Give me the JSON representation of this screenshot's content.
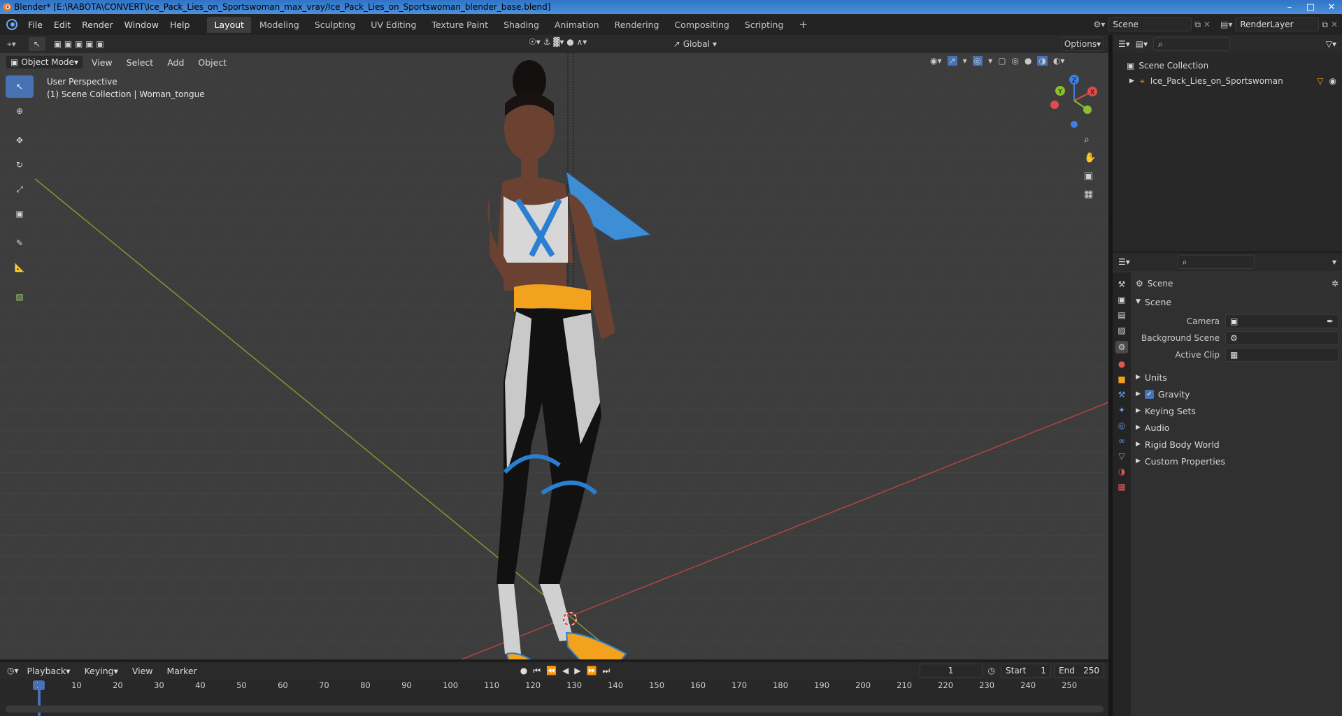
{
  "window": {
    "title": "Blender* [E:\\RABOTA\\CONVERT\\Ice_Pack_Lies_on_Sportswoman_max_vray/Ice_Pack_Lies_on_Sportswoman_blender_base.blend]"
  },
  "menu": [
    "File",
    "Edit",
    "Render",
    "Window",
    "Help"
  ],
  "workspaces": [
    "Layout",
    "Modeling",
    "Sculpting",
    "UV Editing",
    "Texture Paint",
    "Shading",
    "Animation",
    "Rendering",
    "Compositing",
    "Scripting"
  ],
  "scene_field": "Scene",
  "renderlayer_field": "RenderLayer",
  "viewport_header": {
    "orientation": "Global",
    "options": "Options",
    "mode": "Object Mode",
    "menus": [
      "View",
      "Select",
      "Add",
      "Object"
    ]
  },
  "viewport": {
    "perspective": "User Perspective",
    "collection": "(1) Scene Collection | Woman_tongue",
    "gizmo_axes": {
      "z": "Z",
      "y": "Y",
      "x": "X"
    }
  },
  "outliner": {
    "root": "Scene Collection",
    "items": [
      {
        "label": "Ice_Pack_Lies_on_Sportswoman"
      }
    ]
  },
  "properties": {
    "context": "Scene",
    "panel_title": "Scene",
    "fields": [
      {
        "label": "Camera",
        "value": ""
      },
      {
        "label": "Background Scene",
        "value": ""
      },
      {
        "label": "Active Clip",
        "value": ""
      }
    ],
    "subpanels": [
      "Units",
      "Gravity",
      "Keying Sets",
      "Audio",
      "Rigid Body World",
      "Custom Properties"
    ],
    "gravity_checked": true
  },
  "timeline": {
    "menus": [
      "Playback",
      "Keying",
      "View",
      "Marker"
    ],
    "current_frame": "1",
    "start_label": "Start",
    "start": "1",
    "end_label": "End",
    "end": "250",
    "ticks": [
      "1",
      "10",
      "20",
      "30",
      "40",
      "50",
      "60",
      "70",
      "80",
      "90",
      "100",
      "110",
      "120",
      "130",
      "140",
      "150",
      "160",
      "170",
      "180",
      "190",
      "200",
      "210",
      "220",
      "230",
      "240",
      "250"
    ]
  },
  "colors": {
    "accent": "#4772b3",
    "x_axis": "#e04b4b",
    "y_axis": "#8bbf2e",
    "z_axis": "#3f7fe0"
  }
}
